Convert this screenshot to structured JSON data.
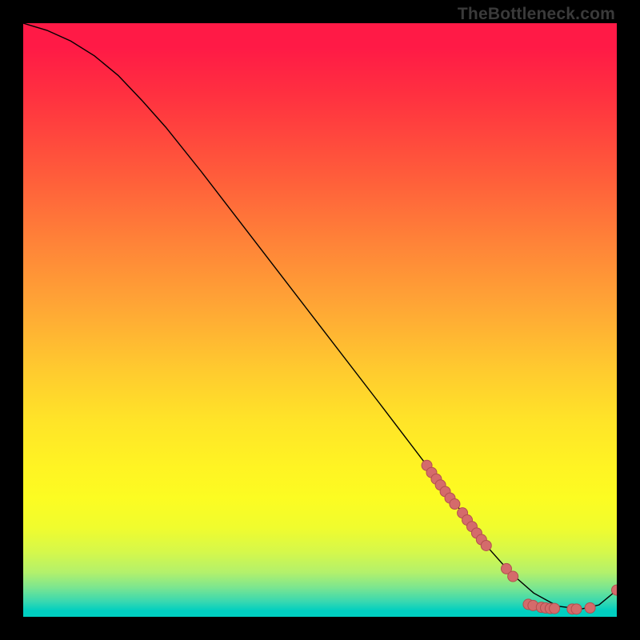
{
  "watermark": "TheBottleneck.com",
  "chart_data": {
    "type": "line",
    "title": "",
    "xlabel": "",
    "ylabel": "",
    "xlim": [
      0,
      100
    ],
    "ylim": [
      0,
      100
    ],
    "grid": false,
    "series": [
      {
        "name": "curve",
        "x": [
          0,
          4,
          8,
          12,
          16,
          20,
          24,
          30,
          40,
          50,
          60,
          68,
          74,
          78,
          82,
          86,
          90,
          94,
          97,
          100
        ],
        "values": [
          100,
          98.8,
          97.0,
          94.5,
          91.2,
          87.0,
          82.5,
          75.0,
          62.0,
          49.0,
          36.0,
          25.5,
          17.5,
          12.0,
          7.5,
          4.0,
          1.8,
          1.3,
          2.0,
          4.5
        ]
      }
    ],
    "markers": [
      {
        "x": 68.0,
        "y": 25.5
      },
      {
        "x": 68.8,
        "y": 24.3
      },
      {
        "x": 69.6,
        "y": 23.2
      },
      {
        "x": 70.3,
        "y": 22.2
      },
      {
        "x": 71.1,
        "y": 21.1
      },
      {
        "x": 71.9,
        "y": 20.0
      },
      {
        "x": 72.7,
        "y": 19.0
      },
      {
        "x": 74.0,
        "y": 17.5
      },
      {
        "x": 74.8,
        "y": 16.3
      },
      {
        "x": 75.6,
        "y": 15.2
      },
      {
        "x": 76.4,
        "y": 14.1
      },
      {
        "x": 77.2,
        "y": 13.0
      },
      {
        "x": 78.0,
        "y": 12.0
      },
      {
        "x": 81.4,
        "y": 8.1
      },
      {
        "x": 82.5,
        "y": 6.8
      },
      {
        "x": 85.1,
        "y": 2.1
      },
      {
        "x": 85.9,
        "y": 1.9
      },
      {
        "x": 87.3,
        "y": 1.6
      },
      {
        "x": 88.0,
        "y": 1.5
      },
      {
        "x": 88.8,
        "y": 1.4
      },
      {
        "x": 89.5,
        "y": 1.4
      },
      {
        "x": 92.5,
        "y": 1.3
      },
      {
        "x": 93.2,
        "y": 1.3
      },
      {
        "x": 95.5,
        "y": 1.5
      },
      {
        "x": 100.0,
        "y": 4.5
      }
    ],
    "style": {
      "line_color": "#000000",
      "line_width": 1.4,
      "marker_fill": "#d46b6b",
      "marker_stroke": "#b34f4f",
      "marker_radius_px": 6.5
    }
  }
}
